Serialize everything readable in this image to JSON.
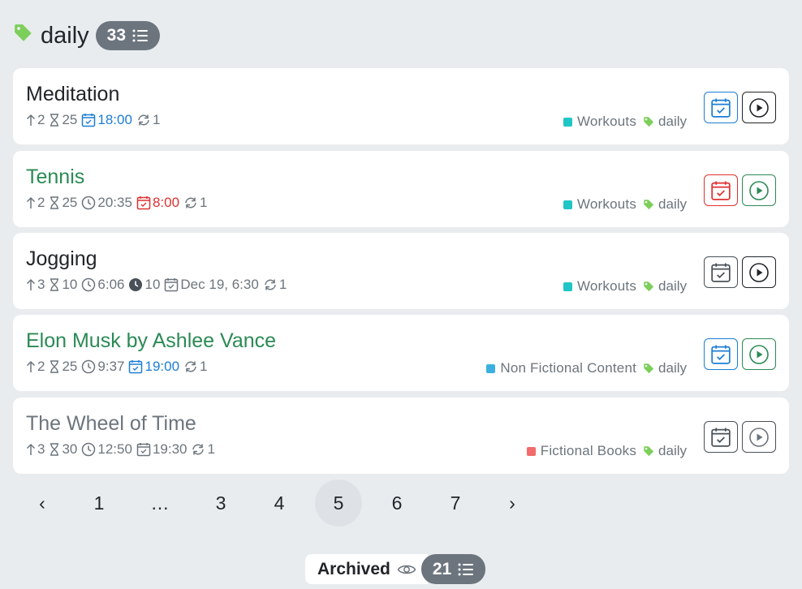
{
  "header": {
    "title": "daily",
    "count": "33"
  },
  "tasks": [
    {
      "name": "Meditation",
      "priority": "2",
      "estimate": "25",
      "due": "18:00",
      "repeat": "1",
      "project": "Workouts",
      "label": "daily"
    },
    {
      "name": "Tennis",
      "priority": "2",
      "estimate": "25",
      "time_spent": "20:35",
      "due": "8:00",
      "repeat": "1",
      "project": "Workouts",
      "label": "daily"
    },
    {
      "name": "Jogging",
      "priority": "3",
      "estimate": "10",
      "time_spent": "6:06",
      "timer": "10",
      "due": "Dec 19, 6:30",
      "repeat": "1",
      "project": "Workouts",
      "label": "daily"
    },
    {
      "name": "Elon Musk by Ashlee Vance",
      "priority": "2",
      "estimate": "25",
      "time_spent": "9:37",
      "due": "19:00",
      "repeat": "1",
      "project": "Non Fictional Content",
      "label": "daily"
    },
    {
      "name": "The Wheel of Time",
      "priority": "3",
      "estimate": "30",
      "time_spent": "12:50",
      "due": "19:30",
      "repeat": "1",
      "project": "Fictional Books",
      "label": "daily"
    }
  ],
  "pagination": {
    "prev": "‹",
    "pages": [
      "1",
      "…",
      "3",
      "4",
      "5",
      "6",
      "7"
    ],
    "current": "5",
    "next": "›"
  },
  "footer": {
    "archived_label": "Archived",
    "archived_count": "21"
  },
  "colors": {
    "label_green": "#7ccf5a",
    "workouts": "#20c5c5",
    "non_fictional": "#3bb0e0",
    "fictional_books": "#f26b6b",
    "due_blue": "#1c7ed6",
    "overdue_red": "#e03131",
    "name_green": "#2b8a55"
  },
  "icons": [
    "tag-icon",
    "list-icon",
    "priority-arrow-icon",
    "hourglass-icon",
    "calendar-check-icon",
    "repeat-icon",
    "clock-icon",
    "play-icon",
    "eye-icon"
  ]
}
